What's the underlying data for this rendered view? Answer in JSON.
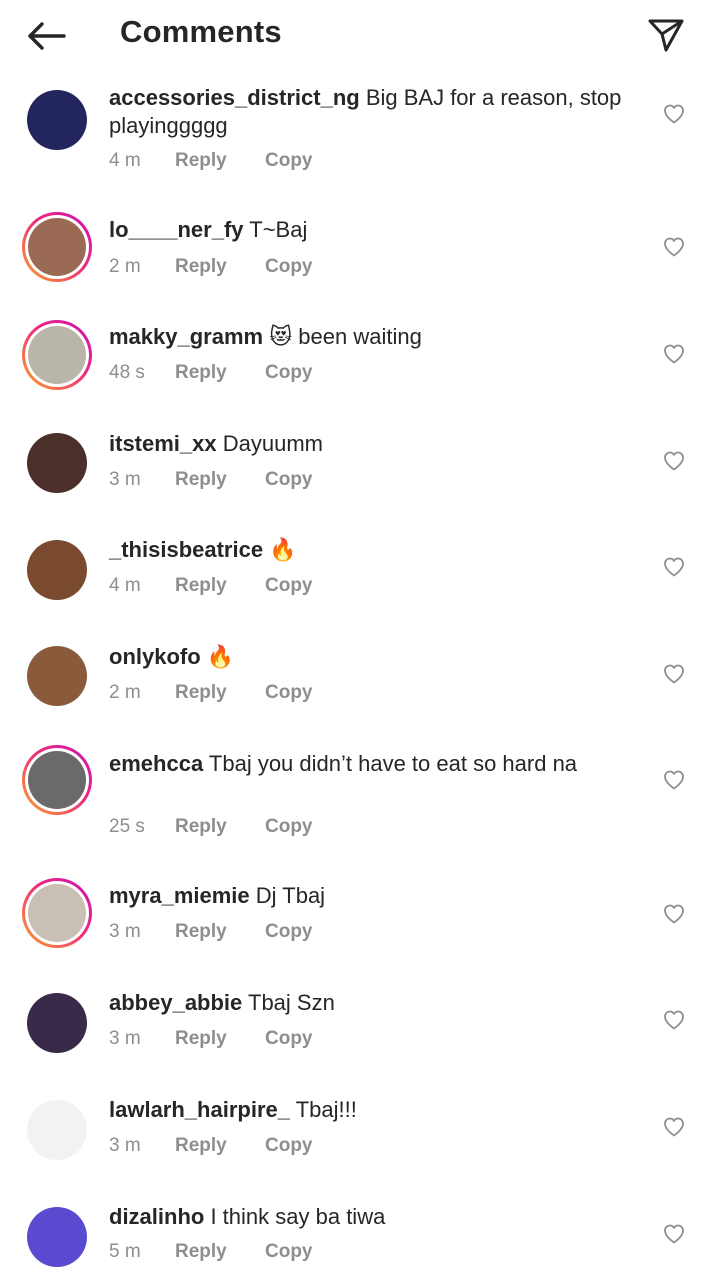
{
  "header": {
    "title": "Comments",
    "back_icon": "arrow-left-icon",
    "share_icon": "paper-plane-icon"
  },
  "comments": [
    {
      "username": "accessories_district_ng",
      "text": "Big BAJ for a reason, stop playinggggg",
      "time": "4 m",
      "reply": "Reply",
      "copy": "Copy",
      "story_ring": false,
      "avatar_color": "#23265e"
    },
    {
      "username": "lo____ner_fy",
      "text": "T~Baj",
      "time": "2 m",
      "reply": "Reply",
      "copy": "Copy",
      "story_ring": true,
      "avatar_color": "#9a6a55"
    },
    {
      "username": "makky_gramm",
      "text": "😻 been waiting",
      "time": "48 s",
      "reply": "Reply",
      "copy": "Copy",
      "story_ring": true,
      "avatar_color": "#b9b5a8"
    },
    {
      "username": "itstemi_xx",
      "text": "Dayuumm",
      "time": "3 m",
      "reply": "Reply",
      "copy": "Copy",
      "story_ring": false,
      "avatar_color": "#4a2f2a"
    },
    {
      "username": "_thisisbeatrice",
      "text": "🔥",
      "time": "4 m",
      "reply": "Reply",
      "copy": "Copy",
      "story_ring": false,
      "avatar_color": "#7a4a2e"
    },
    {
      "username": "onlykofo",
      "text": "🔥",
      "time": "2 m",
      "reply": "Reply",
      "copy": "Copy",
      "story_ring": false,
      "avatar_color": "#8a5a3a"
    },
    {
      "username": "emehcca",
      "text": "Tbaj you didn’t have to eat so hard na",
      "time": "25 s",
      "reply": "Reply",
      "copy": "Copy",
      "story_ring": true,
      "avatar_color": "#6a6a6a"
    },
    {
      "username": "myra_miemie",
      "text": "Dj Tbaj",
      "time": "3 m",
      "reply": "Reply",
      "copy": "Copy",
      "story_ring": true,
      "avatar_color": "#c8c0b4"
    },
    {
      "username": "abbey_abbie",
      "text": "Tbaj Szn",
      "time": "3 m",
      "reply": "Reply",
      "copy": "Copy",
      "story_ring": false,
      "avatar_color": "#3a2a4a"
    },
    {
      "username": "lawlarh_hairpire_",
      "text": "Tbaj!!!",
      "time": "3 m",
      "reply": "Reply",
      "copy": "Copy",
      "story_ring": false,
      "avatar_color": "#f2f2f2"
    },
    {
      "username": "dizalinho",
      "text": "I think say ba tiwa",
      "time": "5 m",
      "reply": "Reply",
      "copy": "Copy",
      "story_ring": false,
      "avatar_color": "#5a4ad0"
    }
  ],
  "colors": {
    "text": "#262626",
    "meta": "#8e8e8e",
    "ring_start": "#f9a72a",
    "ring_end": "#c913b9"
  }
}
